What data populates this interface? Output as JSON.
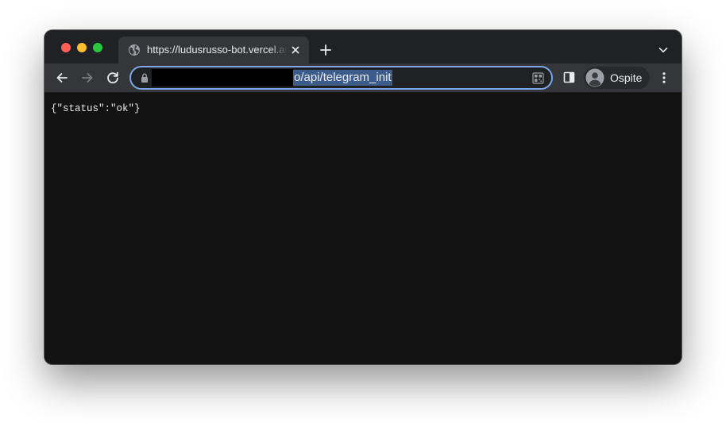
{
  "tab": {
    "title": "https://ludusrusso-bot.vercel.app/api/telegram_init",
    "favicon": "globe-icon"
  },
  "address_bar": {
    "visible_url_tail": "o/api/telegram_init",
    "selection_color": "#3c5d8c",
    "focus_ring_color": "#7ca6e6"
  },
  "profile": {
    "name": "Ospite"
  },
  "page": {
    "body_text": "{\"status\":\"ok\"}"
  },
  "colors": {
    "close": "#ff5f57",
    "minimize": "#febc2e",
    "zoom": "#28c840",
    "tabbar": "#202124",
    "toolbar": "#35363a",
    "content": "#131313"
  }
}
